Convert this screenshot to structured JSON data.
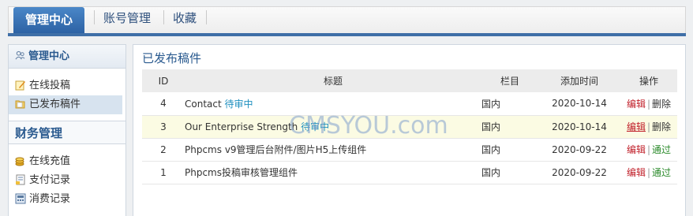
{
  "nav": {
    "tabs": [
      "管理中心",
      "账号管理",
      "收藏"
    ]
  },
  "sidebar": {
    "header": "管理中心",
    "items": [
      "在线投稿",
      "已发布稿件"
    ],
    "finance_header": "财务管理",
    "finance_items": [
      "在线充值",
      "支付记录",
      "消费记录"
    ]
  },
  "main": {
    "title": "已发布稿件",
    "columns": [
      "ID",
      "标题",
      "栏目",
      "添加时间",
      "操作"
    ],
    "rows": [
      {
        "id": "4",
        "title": "Contact",
        "status": "待审中",
        "category": "国内",
        "date": "2020-10-14",
        "op1": "编辑",
        "op2": "删除"
      },
      {
        "id": "3",
        "title": "Our Enterprise Strength",
        "status": "待审中",
        "category": "国内",
        "date": "2020-10-14",
        "op1": "编辑",
        "op2": "删除"
      },
      {
        "id": "2",
        "title": "Phpcms v9管理后台附件/图片H5上传组件",
        "status": "",
        "category": "国内",
        "date": "2020-09-22",
        "op1": "编辑",
        "op2": "通过"
      },
      {
        "id": "1",
        "title": "Phpcms投稿审核管理组件",
        "status": "",
        "category": "国内",
        "date": "2020-09-22",
        "op1": "编辑",
        "op2": "通过"
      }
    ]
  },
  "watermark": "CMSYOU.com",
  "colors": {
    "accent": "#3f6fa7",
    "status": "#1e8fbf",
    "edit": "#c0202a",
    "pass": "#2a8a2a"
  }
}
